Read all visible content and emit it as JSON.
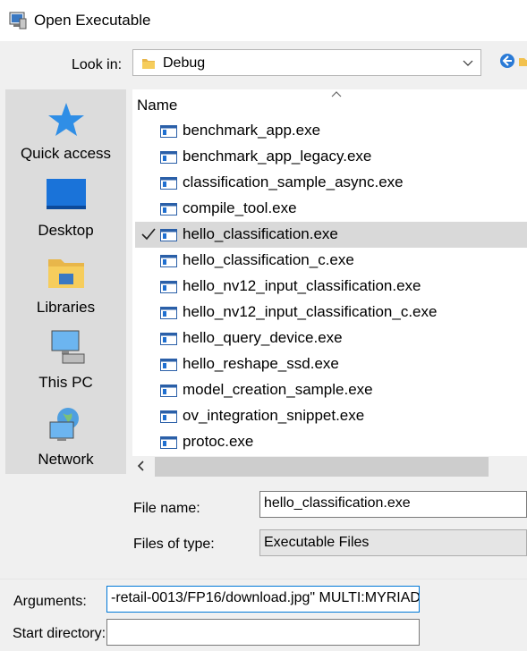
{
  "window": {
    "title": "Open Executable"
  },
  "look_in": {
    "label": "Look in:",
    "value": "Debug"
  },
  "places": [
    {
      "name": "quick-access",
      "label": "Quick access"
    },
    {
      "name": "desktop",
      "label": "Desktop"
    },
    {
      "name": "libraries",
      "label": "Libraries"
    },
    {
      "name": "this-pc",
      "label": "This PC"
    },
    {
      "name": "network",
      "label": "Network"
    }
  ],
  "file_list": {
    "column_header": "Name",
    "files": [
      "benchmark_app.exe",
      "benchmark_app_legacy.exe",
      "classification_sample_async.exe",
      "compile_tool.exe",
      "hello_classification.exe",
      "hello_classification_c.exe",
      "hello_nv12_input_classification.exe",
      "hello_nv12_input_classification_c.exe",
      "hello_query_device.exe",
      "hello_reshape_ssd.exe",
      "model_creation_sample.exe",
      "ov_integration_snippet.exe",
      "protoc.exe"
    ],
    "selected": "hello_classification.exe"
  },
  "file_name": {
    "label": "File name:",
    "value": "hello_classification.exe"
  },
  "file_type": {
    "label": "Files of type:",
    "value": "Executable Files"
  },
  "arguments": {
    "label": "Arguments:",
    "value": "-retail-0013/FP16/download.jpg\" MULTI:MYRIAD"
  },
  "start_directory": {
    "label": "Start directory:",
    "value": ""
  }
}
